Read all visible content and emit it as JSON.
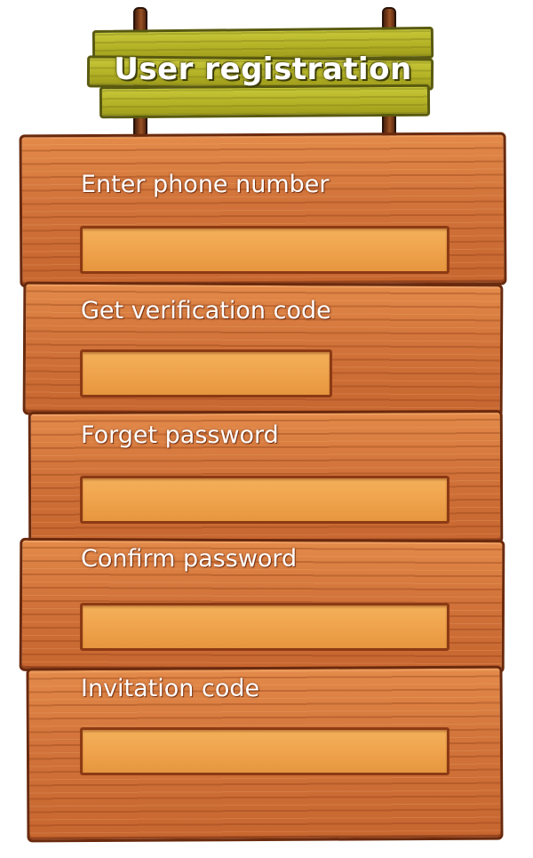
{
  "title": "User registration",
  "colors": {
    "title_board": "#b2b024",
    "wood": "#d1733a",
    "input_fill": "#eea14a",
    "label_text": "#ffffff"
  },
  "fields": [
    {
      "label": "Enter phone number",
      "value": "",
      "placeholder": ""
    },
    {
      "label": "Get verification code",
      "value": "",
      "placeholder": ""
    },
    {
      "label": "Forget password",
      "value": "",
      "placeholder": ""
    },
    {
      "label": "Confirm password",
      "value": "",
      "placeholder": ""
    },
    {
      "label": "Invitation code",
      "value": "",
      "placeholder": ""
    }
  ]
}
